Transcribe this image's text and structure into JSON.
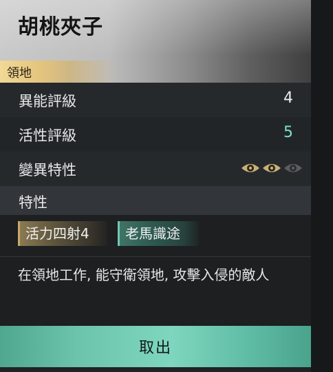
{
  "item": {
    "title": "胡桃夾子",
    "tag": "領地"
  },
  "stats": [
    {
      "label": "異能評級",
      "value": "4"
    },
    {
      "label": "活性評級",
      "value": "5",
      "value_color": "#79e2d4"
    },
    {
      "label": "變異特性",
      "eyes": {
        "active": 2,
        "total": 3
      }
    }
  ],
  "traits_section": {
    "title": "特性",
    "traits": [
      {
        "label": "活力四射4",
        "style": "gold"
      },
      {
        "label": "老馬識途",
        "style": "teal"
      }
    ]
  },
  "description": "在領地工作, 能守衛領地, 攻擊入侵的敵人",
  "action": {
    "take_label": "取出"
  },
  "colors": {
    "gold": "#e4c47d",
    "teal": "#6fc8b1",
    "button": "#7fd6bf"
  }
}
